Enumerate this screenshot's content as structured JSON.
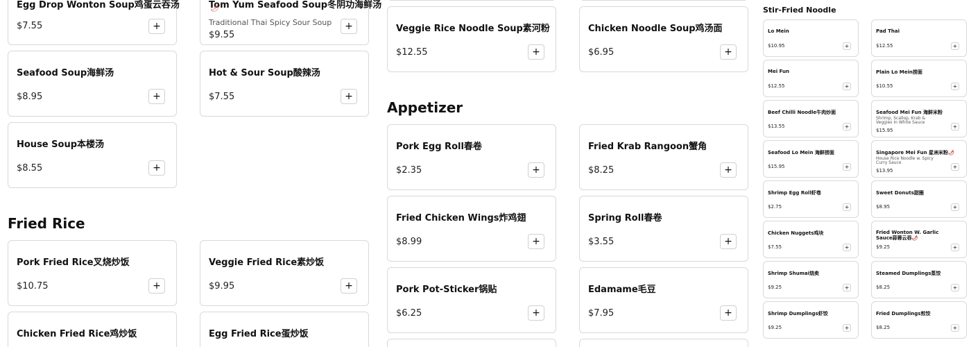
{
  "menu": {
    "add_symbol": "+",
    "chili_glyph": "🌶",
    "col1": {
      "cards": [
        {
          "name": "Egg Drop Wonton Soup鸡蛋云吞汤",
          "price": "$7.55"
        },
        {
          "name": "Seafood Soup海鲜汤",
          "price": "$8.95"
        },
        {
          "name": "House Soup本楼汤",
          "price": "$8.55"
        }
      ]
    },
    "col2": {
      "cards": [
        {
          "name": "Tom Yum Seafood Soup冬阴功海鲜汤",
          "description": "Traditional Thai Spicy Sour Soup",
          "price": "$9.55"
        },
        {
          "name": "Hot & Sour Soup酸辣汤",
          "price": "$7.55"
        }
      ]
    },
    "fried_rice": {
      "title": "Fried Rice",
      "cards": [
        {
          "name": "Pork Fried Rice叉烧炒饭",
          "price": "$10.75"
        },
        {
          "name": "Veggie Fried Rice素炒饭",
          "price": "$9.95"
        },
        {
          "name": "Chicken Fried Rice鸡炒饭"
        },
        {
          "name": "Egg Fried Rice蛋炒饭"
        }
      ]
    },
    "noodle_soup": {
      "cards": [
        {
          "name": "Veggie Rice Noodle Soup素河粉",
          "price": "$12.55"
        },
        {
          "name": "Chicken Noodle Soup鸡汤面",
          "price": "$6.95"
        }
      ]
    },
    "appetizer": {
      "title": "Appetizer",
      "cards": [
        {
          "name": "Pork Egg Roll春卷",
          "price": "$2.35"
        },
        {
          "name": "Fried Krab Rangoon蟹角",
          "price": "$8.25"
        },
        {
          "name": "Fried Chicken Wings炸鸡翅",
          "price": "$8.99"
        },
        {
          "name": "Spring Roll春卷",
          "price": "$3.55"
        },
        {
          "name": "Pork Pot-Sticker锅贴",
          "price": "$6.25"
        },
        {
          "name": "Edamame毛豆",
          "price": "$7.95"
        }
      ]
    },
    "stir_fried_noodle": {
      "title": "Stir-Fried Noodle",
      "cards": [
        {
          "name": "Lo Mein",
          "price": "$10.95"
        },
        {
          "name": "Pad Thai",
          "price": "$12.55"
        },
        {
          "name": "Mei Fun",
          "price": "$12.55"
        },
        {
          "name": "Plain Lo Mein捞面",
          "price": "$10.55"
        },
        {
          "name": "Beef Chilli Noodle牛肉炒面",
          "price": "$13.55"
        },
        {
          "name": "Seafood Mei Fun 海鲜米粉",
          "description": "Shrimp, Scallop, Krab & Veggies In White Sauce",
          "price": "$15.95"
        },
        {
          "name": "Seafood Lo Mein 海鲜捞面",
          "price": "$15.95"
        },
        {
          "name": "Singapore Mei Fun 星洲米粉",
          "description": "House Rice Noodle w. Spicy Curry Sauce",
          "price": "$13.95"
        },
        {
          "name": "Shrimp Egg Roll虾卷",
          "price": "$2.75"
        },
        {
          "name": "Sweet Donuts甜圈",
          "price": "$8.95"
        },
        {
          "name": "Chicken Nuggets鸡块",
          "price": "$7.55"
        },
        {
          "name": "Fried Wonton W. Garlic Sauce蒜蓉云吞",
          "price": "$9.25"
        },
        {
          "name": "Shrimp Shumai烧卖",
          "price": "$9.25"
        },
        {
          "name": "Steamed Dumplings蒸饺",
          "price": "$8.25"
        },
        {
          "name": "Shrimp Dumplings虾饺",
          "price": "$9.25"
        },
        {
          "name": "Fried Dumplings煎饺",
          "price": "$8.25"
        }
      ]
    }
  }
}
